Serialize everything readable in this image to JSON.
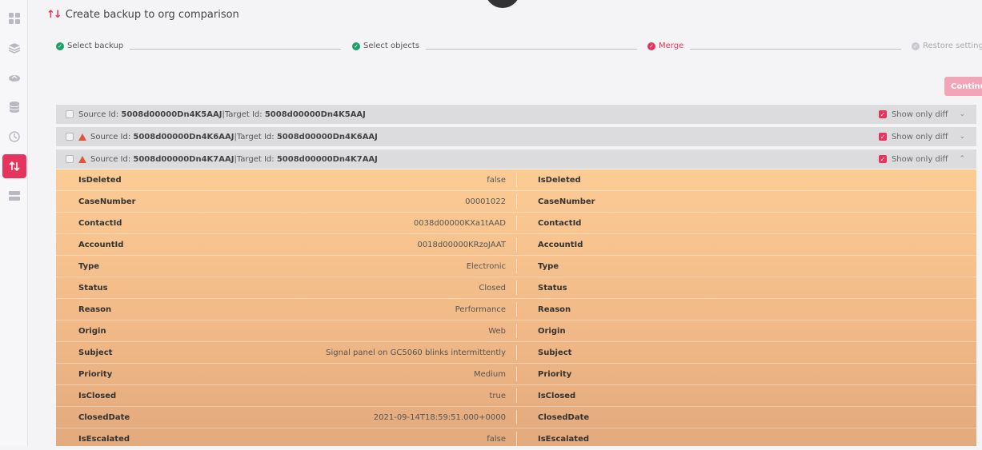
{
  "header": {
    "title": "Create backup to org comparison"
  },
  "stepper": {
    "steps": [
      {
        "label": "Select backup",
        "state": "done"
      },
      {
        "label": "Select objects",
        "state": "done"
      },
      {
        "label": "Merge",
        "state": "current"
      },
      {
        "label": "Restore settings",
        "state": "todo"
      }
    ]
  },
  "continue_label": "Continue",
  "records": [
    {
      "source_label": "Source Id:",
      "source_id": "5008d00000Dn4K5AAJ",
      "sep": "|",
      "target_label": "Target Id:",
      "target_id": "5008d00000Dn4K5AAJ",
      "warning": false,
      "diff_label": "Show only diff",
      "expanded": false
    },
    {
      "source_label": "Source Id:",
      "source_id": "5008d00000Dn4K6AAJ",
      "sep": "|",
      "target_label": "Target Id:",
      "target_id": "5008d00000Dn4K6AAJ",
      "warning": true,
      "diff_label": "Show only diff",
      "expanded": false
    },
    {
      "source_label": "Source Id:",
      "source_id": "5008d00000Dn4K7AAJ",
      "sep": "|",
      "target_label": "Target Id:",
      "target_id": "5008d00000Dn4K7AAJ",
      "warning": true,
      "diff_label": "Show only diff",
      "expanded": true
    }
  ],
  "fields": [
    {
      "name": "IsDeleted",
      "value": "false",
      "target": "IsDeleted"
    },
    {
      "name": "CaseNumber",
      "value": "00001022",
      "target": "CaseNumber"
    },
    {
      "name": "ContactId",
      "value": "0038d00000KXa1tAAD",
      "target": "ContactId"
    },
    {
      "name": "AccountId",
      "value": "0018d00000KRzoJAAT",
      "target": "AccountId"
    },
    {
      "name": "Type",
      "value": "Electronic",
      "target": "Type"
    },
    {
      "name": "Status",
      "value": "Closed",
      "target": "Status"
    },
    {
      "name": "Reason",
      "value": "Performance",
      "target": "Reason"
    },
    {
      "name": "Origin",
      "value": "Web",
      "target": "Origin"
    },
    {
      "name": "Subject",
      "value": "Signal panel on GC5060 blinks intermittently",
      "target": "Subject"
    },
    {
      "name": "Priority",
      "value": "Medium",
      "target": "Priority"
    },
    {
      "name": "IsClosed",
      "value": "true",
      "target": "IsClosed"
    },
    {
      "name": "ClosedDate",
      "value": "2021-09-14T18:59:51.000+0000",
      "target": "ClosedDate"
    },
    {
      "name": "IsEscalated",
      "value": "false",
      "target": "IsEscalated"
    }
  ],
  "colors": {
    "accent": "#e5345d",
    "done": "#1e9e6a",
    "diff_bg": "#fccc95"
  },
  "icons": [
    "dashboard-icon",
    "database-icon",
    "cloud-sync-icon",
    "backup-stack-icon",
    "history-icon",
    "compare-arrows-icon",
    "server-icon",
    "warning-icon",
    "check-icon",
    "chevron-icon"
  ]
}
